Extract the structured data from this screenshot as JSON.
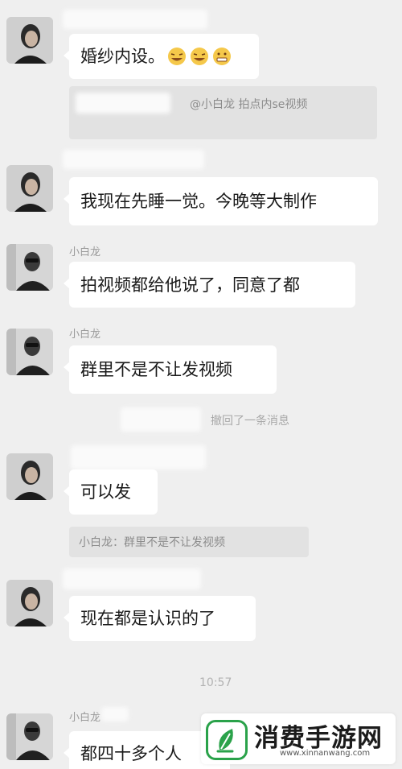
{
  "messages": [
    {
      "text": "婚纱内设。"
    },
    {
      "text": "我现在先睡一觉。今晚等大制作"
    },
    {
      "sender": "小白龙",
      "text": "拍视频都给他说了，同意了都"
    },
    {
      "sender": "小白龙",
      "text": "群里不是不让发视频"
    },
    {
      "text": "可以发"
    },
    {
      "text": "现在都是认识的了"
    },
    {
      "sender": "小白龙",
      "text": "都四十多个人"
    }
  ],
  "quotes": [
    {
      "text": "@小白龙 拍点内se视频"
    },
    {
      "text": "小白龙：群里不是不让发视频"
    }
  ],
  "system_notice": "撤回了一条消息",
  "timestamp": "10:57",
  "emoji_names": [
    "laugh-cry-emoji",
    "laugh-cry-emoji",
    "grin-emoji"
  ],
  "watermark": {
    "title": "消费手游网",
    "url": "www.xinnanwang.com",
    "accent": "#2aa24a"
  }
}
